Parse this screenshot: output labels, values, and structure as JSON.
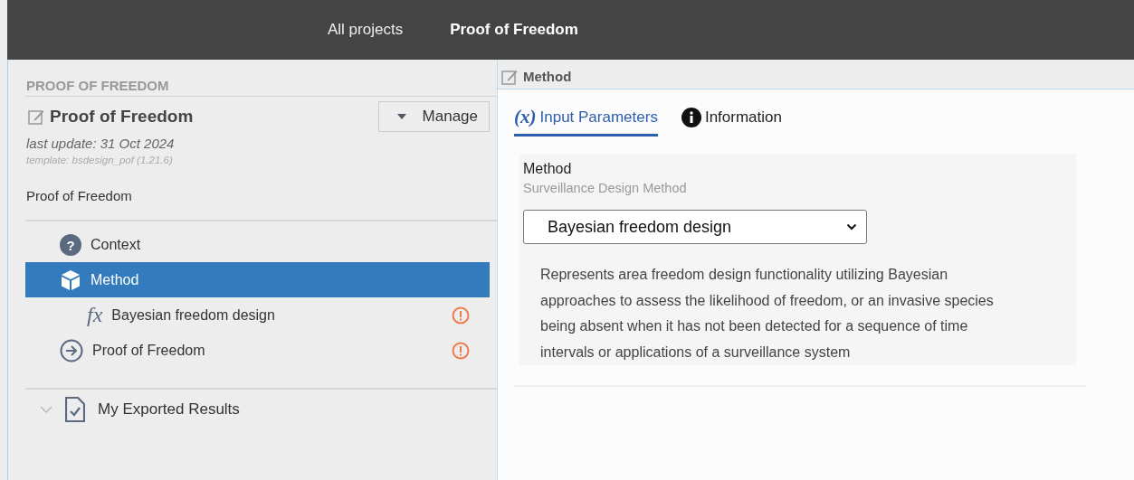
{
  "nav": [
    {
      "label": "All projects",
      "selected": false
    },
    {
      "label": "Proof of Freedom",
      "selected": true
    }
  ],
  "sidebar": {
    "heading": "PROOF OF FREEDOM",
    "title": "Proof of Freedom",
    "manage_button": "Manage",
    "last_update": "last update: 31 Oct 2024",
    "template": "template: bsdesign_pof (1.21.6)",
    "description": "Proof of Freedom",
    "tree": [
      {
        "kind": "question",
        "icon": "?",
        "label": "Context",
        "selected": false,
        "warning": false
      },
      {
        "kind": "cube",
        "label": "Method",
        "selected": true,
        "warning": false,
        "children": [
          {
            "kind": "function",
            "icon": "fx",
            "label": "Bayesian freedom design",
            "selected": false,
            "warning": true
          }
        ]
      },
      {
        "kind": "arrow",
        "label": "Proof of Freedom",
        "selected": false,
        "warning": true
      }
    ],
    "results": {
      "label": "My Exported Results",
      "expanded": true
    }
  },
  "main": {
    "header": "Method",
    "tabs": [
      {
        "kind": "variable",
        "icon": "(x)",
        "label": "Input Parameters",
        "selected": true
      },
      {
        "kind": "info",
        "label": "Information",
        "selected": false
      }
    ],
    "field": {
      "label": "Method",
      "hint": "Surveillance Design Method",
      "value": "Bayesian freedom design",
      "description": "Represents area freedom design functionality utilizing Bayesian approaches to assess the likelihood of freedom, or an invasive species being absent when it has not been detected for a sequence of time intervals or applications of a surveillance system"
    }
  }
}
